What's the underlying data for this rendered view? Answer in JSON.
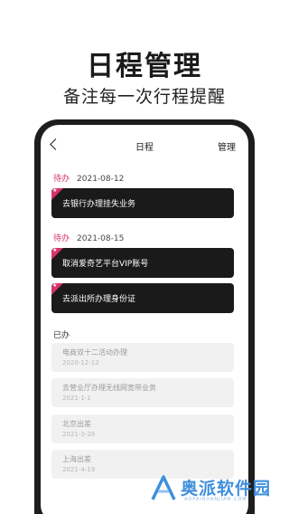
{
  "promo": {
    "title": "日程管理",
    "subtitle": "备注每一次行程提醒"
  },
  "nav": {
    "back_icon": "chevron-left-icon",
    "title": "日程",
    "action_label": "管理"
  },
  "pending_groups": [
    {
      "status": "待办",
      "date": "2021-08-12",
      "tasks": [
        "去银行办理挂失业务"
      ]
    },
    {
      "status": "待办",
      "date": "2021-08-15",
      "tasks": [
        "取消爱奇艺平台VIP账号",
        "去派出所办理身份证"
      ]
    }
  ],
  "done_section": {
    "label": "已办",
    "items": [
      {
        "title": "电商双十二活动办理",
        "date": "2020-12-12"
      },
      {
        "title": "去营业厅办理无线网宽带业务",
        "date": "2021-1-1"
      },
      {
        "title": "北京出差",
        "date": "2021-3-28"
      },
      {
        "title": "上海出差",
        "date": "2021-4-19"
      }
    ]
  },
  "colors": {
    "accent": "#d6326a",
    "card_dark": "#1a1a1a",
    "done_card": "#f1f1f1",
    "phone_frame": "#1d1d1d",
    "watermark": "#3f8fdc"
  },
  "watermark": {
    "text": "奥派软件园",
    "sub": "AOPAIRUANJIAN.COM",
    "icon": "logo-a-icon"
  }
}
